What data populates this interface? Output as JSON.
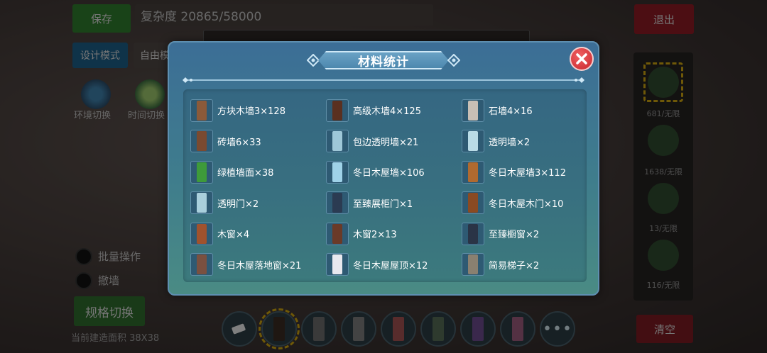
{
  "background": {
    "save_button": "保存",
    "complexity": "复杂度 20865/58000",
    "exit_button": "退出",
    "design_mode_button": "设计模式",
    "free_mode_button": "自由模",
    "tool_env_label": "环境切换",
    "tool_time_label": "时间切换",
    "batch_op_label": "批量操作",
    "wall_toggle_label": "撤墙",
    "spec_switch_button": "规格切换",
    "build_size_text": "当前建造面积 38X38",
    "clear_button": "清空",
    "right_panel_labels": [
      "681/无限",
      "1638/无限",
      "13/无限",
      "116/无限"
    ],
    "more_icon": "more-dots-icon"
  },
  "modal": {
    "title": "材料统计",
    "close_icon": "close-x-icon",
    "items": [
      {
        "label": "方块木墙3×128",
        "color": "#8b5a3a",
        "icon": "block-wood-wall-icon"
      },
      {
        "label": "高级木墙4×125",
        "color": "#5a3020",
        "icon": "premium-wood-wall-icon"
      },
      {
        "label": "石墙4×16",
        "color": "#c8bfb5",
        "icon": "stone-wall-icon"
      },
      {
        "label": "砖墙6×33",
        "color": "#7a4a30",
        "icon": "brick-wall-icon"
      },
      {
        "label": "包边透明墙×21",
        "color": "#9ec7d8",
        "icon": "framed-glass-wall-icon"
      },
      {
        "label": "透明墙×2",
        "color": "#b9dbe6",
        "icon": "glass-wall-icon"
      },
      {
        "label": "绿植墙面×38",
        "color": "#3e9a3a",
        "icon": "plant-wall-icon"
      },
      {
        "label": "冬日木屋墙×106",
        "color": "#9fd2e8",
        "icon": "winter-cabin-wall-icon"
      },
      {
        "label": "冬日木屋墙3×112",
        "color": "#b06a30",
        "icon": "winter-cabin-wall-3-icon"
      },
      {
        "label": "透明门×2",
        "color": "#a9cfdc",
        "icon": "glass-door-icon"
      },
      {
        "label": "至臻展柜门×1",
        "color": "#2b3b52",
        "icon": "deluxe-showcase-door-icon"
      },
      {
        "label": "冬日木屋木门×10",
        "color": "#8a4a22",
        "icon": "winter-cabin-door-icon"
      },
      {
        "label": "木窗×4",
        "color": "#a0522d",
        "icon": "wood-window-icon"
      },
      {
        "label": "木窗2×13",
        "color": "#6a3a28",
        "icon": "wood-window-2-icon"
      },
      {
        "label": "至臻橱窗×2",
        "color": "#2a3446",
        "icon": "deluxe-display-window-icon"
      },
      {
        "label": "冬日木屋落地窗×21",
        "color": "#7a5040",
        "icon": "winter-cabin-french-window-icon"
      },
      {
        "label": "冬日木屋屋顶×12",
        "color": "#e8e8ee",
        "icon": "winter-cabin-roof-icon"
      },
      {
        "label": "简易梯子×2",
        "color": "#8a8070",
        "icon": "simple-ladder-icon"
      }
    ]
  }
}
